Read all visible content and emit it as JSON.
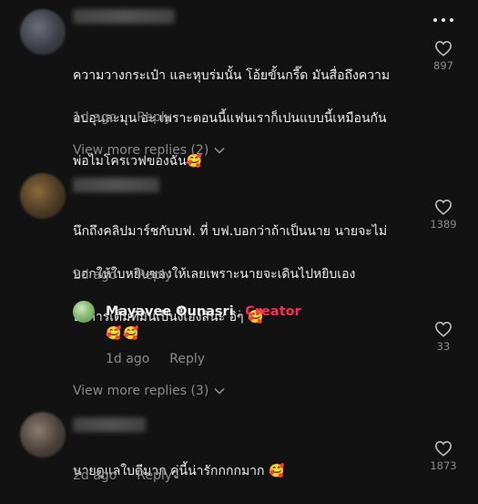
{
  "comments": [
    {
      "text": "ความวางกระเป๋า และหุบร่มนั้น โอ้ยขั้นกรี๊ด มันสื่อถึงความอบอุนละมุน อ่ะ เพราะตอนนี้แฟนเราก็เปนแบบนี้เหมือนกัน พ่อไม่โครเวฟของฉัน🥰",
      "line1": "ความวางกระเป๋า และหุบร่มนั้น โอ้ยขั้นกรี๊ด มันสื่อถึงความ",
      "line2": "อบอุนละมุน อ่ะ เพราะตอนนี้แฟนเราก็เปนแบบนี้เหมือนกัน",
      "line3": "พ่อไมโครเวฟของฉัน🥰",
      "time": "1d ago",
      "reply": "Reply",
      "likes": "897",
      "view_replies": "View more replies (2)"
    },
    {
      "line1": "นึกถึงคลิปมาร์ชกับบฟ. ที่ บฟ.บอกว่าถ้าเป็นนาย นายจะไม่",
      "line2": "บอกให้ใบหยิบของให้เลยเพราะนายจะเดินไปหยิบเอง",
      "line3": "บริการเต็มที่มันเป็นงี้เองสินะ อิๆ 🥰",
      "time": "2d ago",
      "reply": "Reply",
      "likes": "1389",
      "view_replies": "View more replies (3)"
    },
    {
      "line1": "นายดูแลใบดีมาก คู่นี้น่ารักกกกมาก 🥰",
      "time": "2d ago",
      "reply": "Reply",
      "likes": "1873"
    }
  ],
  "creator_reply": {
    "name": "Mayavee Ounasri",
    "separator": "·",
    "badge": "Creator",
    "text": "🥰🥰",
    "time": "1d ago",
    "reply": "Reply",
    "likes": "33"
  },
  "colors": {
    "background": "#121212",
    "creator_badge": "#fe2c55",
    "muted": "#8a8a8a"
  },
  "icons": {
    "more": "more-horizontal-icon",
    "like": "heart-outline-icon",
    "expand": "chevron-down-icon"
  }
}
